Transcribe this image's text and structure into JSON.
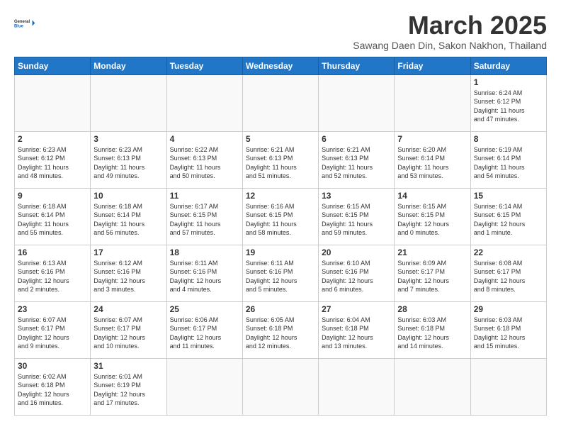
{
  "header": {
    "logo_general": "General",
    "logo_blue": "Blue",
    "month_title": "March 2025",
    "subtitle": "Sawang Daen Din, Sakon Nakhon, Thailand"
  },
  "weekdays": [
    "Sunday",
    "Monday",
    "Tuesday",
    "Wednesday",
    "Thursday",
    "Friday",
    "Saturday"
  ],
  "weeks": [
    [
      {
        "day": "",
        "info": ""
      },
      {
        "day": "",
        "info": ""
      },
      {
        "day": "",
        "info": ""
      },
      {
        "day": "",
        "info": ""
      },
      {
        "day": "",
        "info": ""
      },
      {
        "day": "",
        "info": ""
      },
      {
        "day": "1",
        "info": "Sunrise: 6:24 AM\nSunset: 6:12 PM\nDaylight: 11 hours\nand 47 minutes."
      }
    ],
    [
      {
        "day": "2",
        "info": "Sunrise: 6:23 AM\nSunset: 6:12 PM\nDaylight: 11 hours\nand 48 minutes."
      },
      {
        "day": "3",
        "info": "Sunrise: 6:23 AM\nSunset: 6:13 PM\nDaylight: 11 hours\nand 49 minutes."
      },
      {
        "day": "4",
        "info": "Sunrise: 6:22 AM\nSunset: 6:13 PM\nDaylight: 11 hours\nand 50 minutes."
      },
      {
        "day": "5",
        "info": "Sunrise: 6:21 AM\nSunset: 6:13 PM\nDaylight: 11 hours\nand 51 minutes."
      },
      {
        "day": "6",
        "info": "Sunrise: 6:21 AM\nSunset: 6:13 PM\nDaylight: 11 hours\nand 52 minutes."
      },
      {
        "day": "7",
        "info": "Sunrise: 6:20 AM\nSunset: 6:14 PM\nDaylight: 11 hours\nand 53 minutes."
      },
      {
        "day": "8",
        "info": "Sunrise: 6:19 AM\nSunset: 6:14 PM\nDaylight: 11 hours\nand 54 minutes."
      }
    ],
    [
      {
        "day": "9",
        "info": "Sunrise: 6:18 AM\nSunset: 6:14 PM\nDaylight: 11 hours\nand 55 minutes."
      },
      {
        "day": "10",
        "info": "Sunrise: 6:18 AM\nSunset: 6:14 PM\nDaylight: 11 hours\nand 56 minutes."
      },
      {
        "day": "11",
        "info": "Sunrise: 6:17 AM\nSunset: 6:15 PM\nDaylight: 11 hours\nand 57 minutes."
      },
      {
        "day": "12",
        "info": "Sunrise: 6:16 AM\nSunset: 6:15 PM\nDaylight: 11 hours\nand 58 minutes."
      },
      {
        "day": "13",
        "info": "Sunrise: 6:15 AM\nSunset: 6:15 PM\nDaylight: 11 hours\nand 59 minutes."
      },
      {
        "day": "14",
        "info": "Sunrise: 6:15 AM\nSunset: 6:15 PM\nDaylight: 12 hours\nand 0 minutes."
      },
      {
        "day": "15",
        "info": "Sunrise: 6:14 AM\nSunset: 6:15 PM\nDaylight: 12 hours\nand 1 minute."
      }
    ],
    [
      {
        "day": "16",
        "info": "Sunrise: 6:13 AM\nSunset: 6:16 PM\nDaylight: 12 hours\nand 2 minutes."
      },
      {
        "day": "17",
        "info": "Sunrise: 6:12 AM\nSunset: 6:16 PM\nDaylight: 12 hours\nand 3 minutes."
      },
      {
        "day": "18",
        "info": "Sunrise: 6:11 AM\nSunset: 6:16 PM\nDaylight: 12 hours\nand 4 minutes."
      },
      {
        "day": "19",
        "info": "Sunrise: 6:11 AM\nSunset: 6:16 PM\nDaylight: 12 hours\nand 5 minutes."
      },
      {
        "day": "20",
        "info": "Sunrise: 6:10 AM\nSunset: 6:16 PM\nDaylight: 12 hours\nand 6 minutes."
      },
      {
        "day": "21",
        "info": "Sunrise: 6:09 AM\nSunset: 6:17 PM\nDaylight: 12 hours\nand 7 minutes."
      },
      {
        "day": "22",
        "info": "Sunrise: 6:08 AM\nSunset: 6:17 PM\nDaylight: 12 hours\nand 8 minutes."
      }
    ],
    [
      {
        "day": "23",
        "info": "Sunrise: 6:07 AM\nSunset: 6:17 PM\nDaylight: 12 hours\nand 9 minutes."
      },
      {
        "day": "24",
        "info": "Sunrise: 6:07 AM\nSunset: 6:17 PM\nDaylight: 12 hours\nand 10 minutes."
      },
      {
        "day": "25",
        "info": "Sunrise: 6:06 AM\nSunset: 6:17 PM\nDaylight: 12 hours\nand 11 minutes."
      },
      {
        "day": "26",
        "info": "Sunrise: 6:05 AM\nSunset: 6:18 PM\nDaylight: 12 hours\nand 12 minutes."
      },
      {
        "day": "27",
        "info": "Sunrise: 6:04 AM\nSunset: 6:18 PM\nDaylight: 12 hours\nand 13 minutes."
      },
      {
        "day": "28",
        "info": "Sunrise: 6:03 AM\nSunset: 6:18 PM\nDaylight: 12 hours\nand 14 minutes."
      },
      {
        "day": "29",
        "info": "Sunrise: 6:03 AM\nSunset: 6:18 PM\nDaylight: 12 hours\nand 15 minutes."
      }
    ],
    [
      {
        "day": "30",
        "info": "Sunrise: 6:02 AM\nSunset: 6:18 PM\nDaylight: 12 hours\nand 16 minutes."
      },
      {
        "day": "31",
        "info": "Sunrise: 6:01 AM\nSunset: 6:19 PM\nDaylight: 12 hours\nand 17 minutes."
      },
      {
        "day": "",
        "info": ""
      },
      {
        "day": "",
        "info": ""
      },
      {
        "day": "",
        "info": ""
      },
      {
        "day": "",
        "info": ""
      },
      {
        "day": "",
        "info": ""
      }
    ]
  ]
}
